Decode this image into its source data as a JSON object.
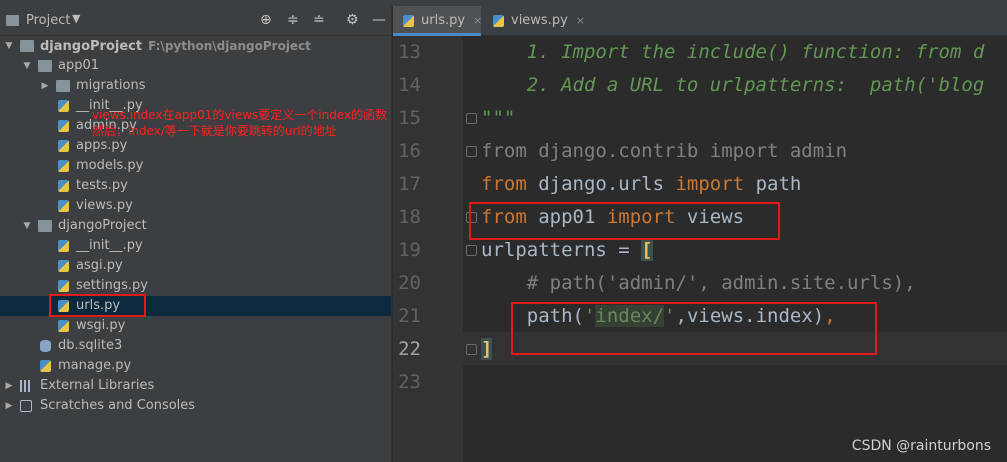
{
  "project_panel": {
    "title": "Project",
    "tree": [
      {
        "label": "djangoProject",
        "path": "F:\\python\\djangoProject"
      },
      {
        "label": "app01"
      },
      {
        "label": "migrations"
      },
      {
        "label": "__init__.py"
      },
      {
        "label": "admin.py"
      },
      {
        "label": "apps.py"
      },
      {
        "label": "models.py"
      },
      {
        "label": "tests.py"
      },
      {
        "label": "views.py"
      },
      {
        "label": "djangoProject"
      },
      {
        "label": "__init__.py"
      },
      {
        "label": "asgi.py"
      },
      {
        "label": "settings.py"
      },
      {
        "label": "urls.py"
      },
      {
        "label": "wsgi.py"
      },
      {
        "label": "db.sqlite3"
      },
      {
        "label": "manage.py"
      },
      {
        "label": "External Libraries"
      },
      {
        "label": "Scratches and Consoles"
      }
    ]
  },
  "annotation": {
    "line1": "views.index在app01的views要定义一个index的函数",
    "line2": "然后，index/等一下就是你要跳转的url的地址"
  },
  "tabs": [
    {
      "label": "urls.py",
      "close": "×"
    },
    {
      "label": "views.py",
      "close": "×"
    }
  ],
  "editor": {
    "line_numbers": [
      "13",
      "14",
      "15",
      "16",
      "17",
      "18",
      "19",
      "20",
      "21",
      "22",
      "23"
    ],
    "l13": "    1. Import the include() function: from d",
    "l14": "    2. Add a URL to urlpatterns:  path('blog",
    "l15": "\"\"\"",
    "l16": "from django.contrib import admin",
    "l17_a": "from",
    "l17_b": " django.urls ",
    "l17_c": "import",
    "l17_d": " path",
    "l18_a": "from",
    "l18_b": " app01 ",
    "l18_c": "import",
    "l18_d": " views",
    "l19_a": "urlpatterns = ",
    "l19_b": "[",
    "l20": "    # path('admin/', admin.site.urls),",
    "l21_a": "    path(",
    "l21_b": "'",
    "l21_c": "index/",
    "l21_d": "'",
    "l21_e": ",views.index)",
    "l21_f": ",",
    "l22": "]"
  },
  "watermark": "CSDN @rainturbons"
}
